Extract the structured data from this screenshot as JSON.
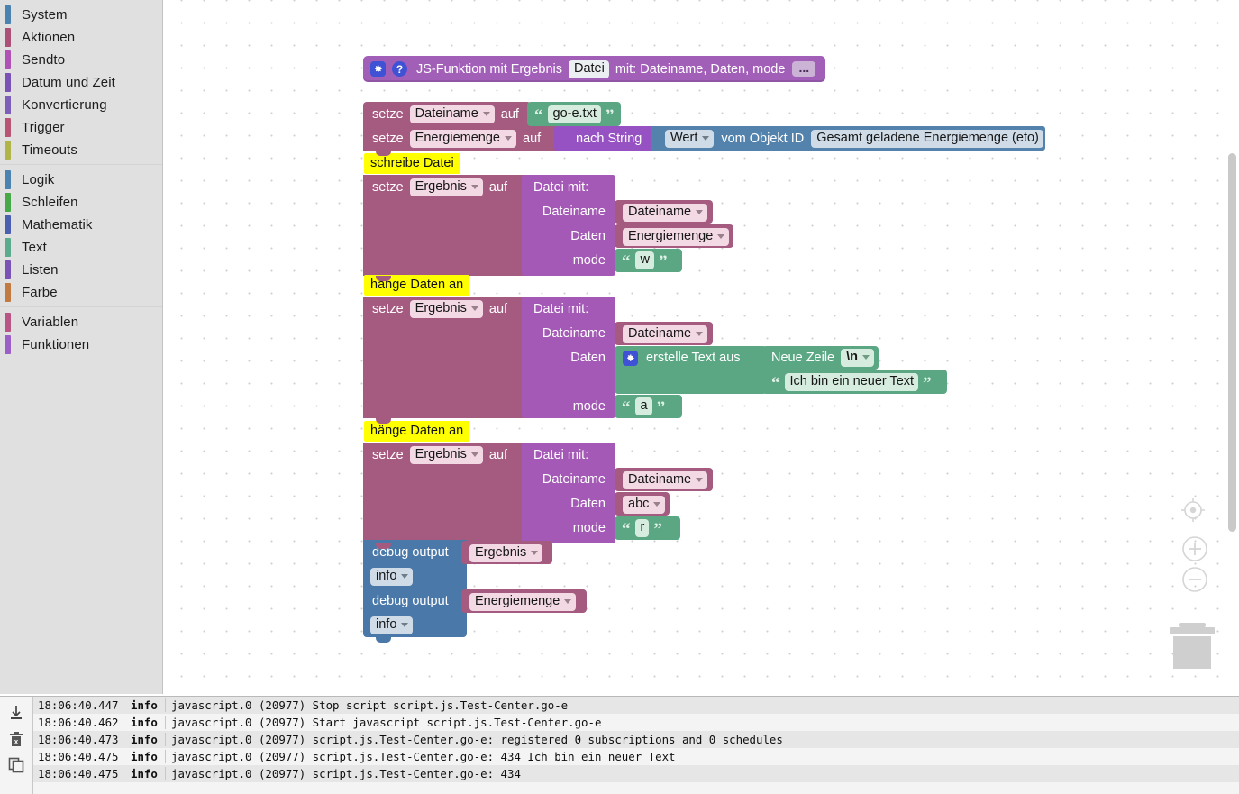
{
  "sidebar": {
    "groups": [
      {
        "items": [
          {
            "label": "System",
            "color": "#4a82b0",
            "icon": "swatch-icon"
          },
          {
            "label": "Aktionen",
            "color": "#ac5078",
            "icon": "swatch-icon"
          },
          {
            "label": "Sendto",
            "color": "#b052b5",
            "icon": "swatch-icon"
          },
          {
            "label": "Datum und Zeit",
            "color": "#7b52b5",
            "icon": "swatch-icon"
          },
          {
            "label": "Konvertierung",
            "color": "#7b5fb8",
            "icon": "swatch-icon"
          },
          {
            "label": "Trigger",
            "color": "#b85575",
            "icon": "swatch-icon"
          },
          {
            "label": "Timeouts",
            "color": "#b0b54a",
            "icon": "swatch-icon"
          }
        ]
      },
      {
        "items": [
          {
            "label": "Logik",
            "color": "#4a82b0",
            "icon": "swatch-icon"
          },
          {
            "label": "Schleifen",
            "color": "#46a846",
            "icon": "swatch-icon"
          },
          {
            "label": "Mathematik",
            "color": "#4a5fb0",
            "icon": "swatch-icon"
          },
          {
            "label": "Text",
            "color": "#5bab8e",
            "icon": "swatch-icon"
          },
          {
            "label": "Listen",
            "color": "#7b52b5",
            "icon": "swatch-icon"
          },
          {
            "label": "Farbe",
            "color": "#c07a42",
            "icon": "swatch-icon"
          }
        ]
      },
      {
        "items": [
          {
            "label": "Variablen",
            "color": "#b85585",
            "icon": "swatch-icon"
          },
          {
            "label": "Funktionen",
            "color": "#9b5fc7",
            "icon": "swatch-icon"
          }
        ]
      }
    ]
  },
  "workspace": {
    "function_header": {
      "gear_icon": "gear-icon",
      "help_icon": "help-icon",
      "prefix": "JS-Funktion mit Ergebnis",
      "name": "Datei",
      "params_label": "mit: Dateiname, Daten, mode",
      "ellipsis": "..."
    },
    "set_dateiname": {
      "keyword": "setze",
      "variable": "Dateiname",
      "auf": "auf",
      "value": "go-e.txt"
    },
    "set_energiemenge": {
      "keyword": "setze",
      "variable": "Energiemenge",
      "auf": "auf",
      "cast_label": "nach String",
      "attr": "Wert",
      "object_label": "vom Objekt ID",
      "object_id": "Gesamt geladene Energiemenge (eto)"
    },
    "tip_schreibe": "schreibe Datei",
    "tip_haenge_1": "hänge Daten an",
    "tip_haenge_2": "hänge Daten an",
    "call_1": {
      "keyword": "setze",
      "variable": "Ergebnis",
      "auf": "auf",
      "call_title": "Datei  mit:",
      "rows": [
        {
          "label": "Dateiname",
          "value": "Dateiname",
          "kind": "variable"
        },
        {
          "label": "Daten",
          "value": "Energiemenge",
          "kind": "variable"
        },
        {
          "label": "mode",
          "value": "w",
          "kind": "string"
        }
      ]
    },
    "call_2": {
      "keyword": "setze",
      "variable": "Ergebnis",
      "auf": "auf",
      "call_title": "Datei  mit:",
      "rows": [
        {
          "label": "Dateiname",
          "value": "Dateiname",
          "kind": "variable"
        },
        {
          "label": "Daten",
          "value": "",
          "kind": "join"
        },
        {
          "label": "mode",
          "value": "a",
          "kind": "string"
        }
      ],
      "join": {
        "gear_icon": "gear-icon",
        "label": "erstelle Text aus",
        "item_1_label": "Neue Zeile",
        "item_1_value": "\\n",
        "item_2_value": "Ich bin ein neuer Text"
      }
    },
    "call_3": {
      "keyword": "setze",
      "variable": "Ergebnis",
      "auf": "auf",
      "call_title": "Datei  mit:",
      "rows": [
        {
          "label": "Dateiname",
          "value": "Dateiname",
          "kind": "variable"
        },
        {
          "label": "Daten",
          "value": "abc",
          "kind": "variable"
        },
        {
          "label": "mode",
          "value": "r",
          "kind": "string"
        }
      ]
    },
    "debug_1": {
      "label": "debug output",
      "value": "Ergebnis",
      "level": "info"
    },
    "debug_2": {
      "label": "debug output",
      "value": "Energiemenge",
      "level": "info"
    },
    "controls": {
      "center_icon": "center-target-icon",
      "zoom_in_icon": "zoom-in-icon",
      "zoom_out_icon": "zoom-out-icon",
      "trash_icon": "trash-icon",
      "zoom_in_label": "+",
      "zoom_out_label": "−"
    }
  },
  "log": {
    "tools": [
      {
        "icon": "download-icon",
        "name": "export-log"
      },
      {
        "icon": "trash-delete-icon",
        "name": "clear-log"
      },
      {
        "icon": "copy-icon",
        "name": "copy-log"
      }
    ],
    "rows": [
      {
        "time": "18:06:40.447",
        "severity": "info",
        "message": "javascript.0 (20977) Stop script script.js.Test-Center.go-e"
      },
      {
        "time": "18:06:40.462",
        "severity": "info",
        "message": "javascript.0 (20977) Start javascript script.js.Test-Center.go-e"
      },
      {
        "time": "18:06:40.473",
        "severity": "info",
        "message": "javascript.0 (20977) script.js.Test-Center.go-e: registered 0 subscriptions and 0 schedules"
      },
      {
        "time": "18:06:40.475",
        "severity": "info",
        "message": "javascript.0 (20977) script.js.Test-Center.go-e: 434 Ich bin ein neuer Text"
      },
      {
        "time": "18:06:40.475",
        "severity": "info",
        "message": "javascript.0 (20977) script.js.Test-Center.go-e: 434"
      }
    ]
  },
  "colors": {
    "variable_block": "#a55b80",
    "function_block": "#a359b5",
    "text_block": "#5ba783",
    "debug_block": "#4a78a8",
    "object_block": "#5383ad",
    "convert_block": "#9652c2",
    "tip_highlight": "#ffff00"
  }
}
